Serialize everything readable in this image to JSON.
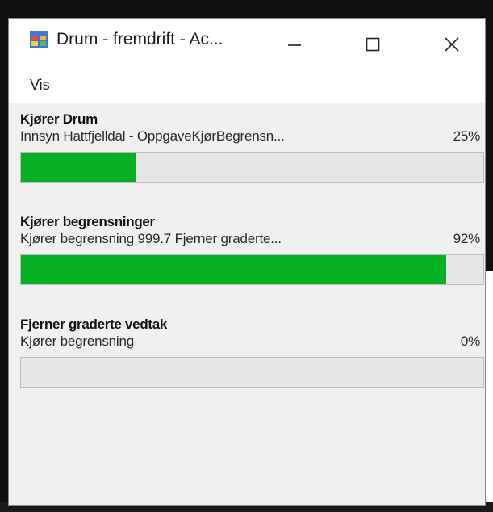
{
  "window": {
    "title": "Drum - fremdrift - Ac...",
    "icon": "app-window-icon",
    "controls": [
      "minimize-icon",
      "maximize-icon",
      "close-icon"
    ]
  },
  "menu": {
    "items": [
      {
        "label": "Vis"
      }
    ]
  },
  "tasks": [
    {
      "title": "Kjører Drum",
      "detail": "Innsyn Hattfjelldal - OppgaveKjørBegrensn...",
      "percent_label": "25%",
      "progress": 0.25
    },
    {
      "title": "Kjører begrensninger",
      "detail": "Kjører begrensning 999.7 Fjerner graderte...",
      "percent_label": "92%",
      "progress": 0.92
    },
    {
      "title": "Fjerner graderte vedtak",
      "detail": "Kjører begrensning",
      "percent_label": "0%",
      "progress": 0
    }
  ],
  "colors": {
    "progress_fill": "#06b025",
    "progress_track": "#e6e6e6",
    "window_bg": "#f0f0f0",
    "titlebar_bg": "#ffffff"
  }
}
